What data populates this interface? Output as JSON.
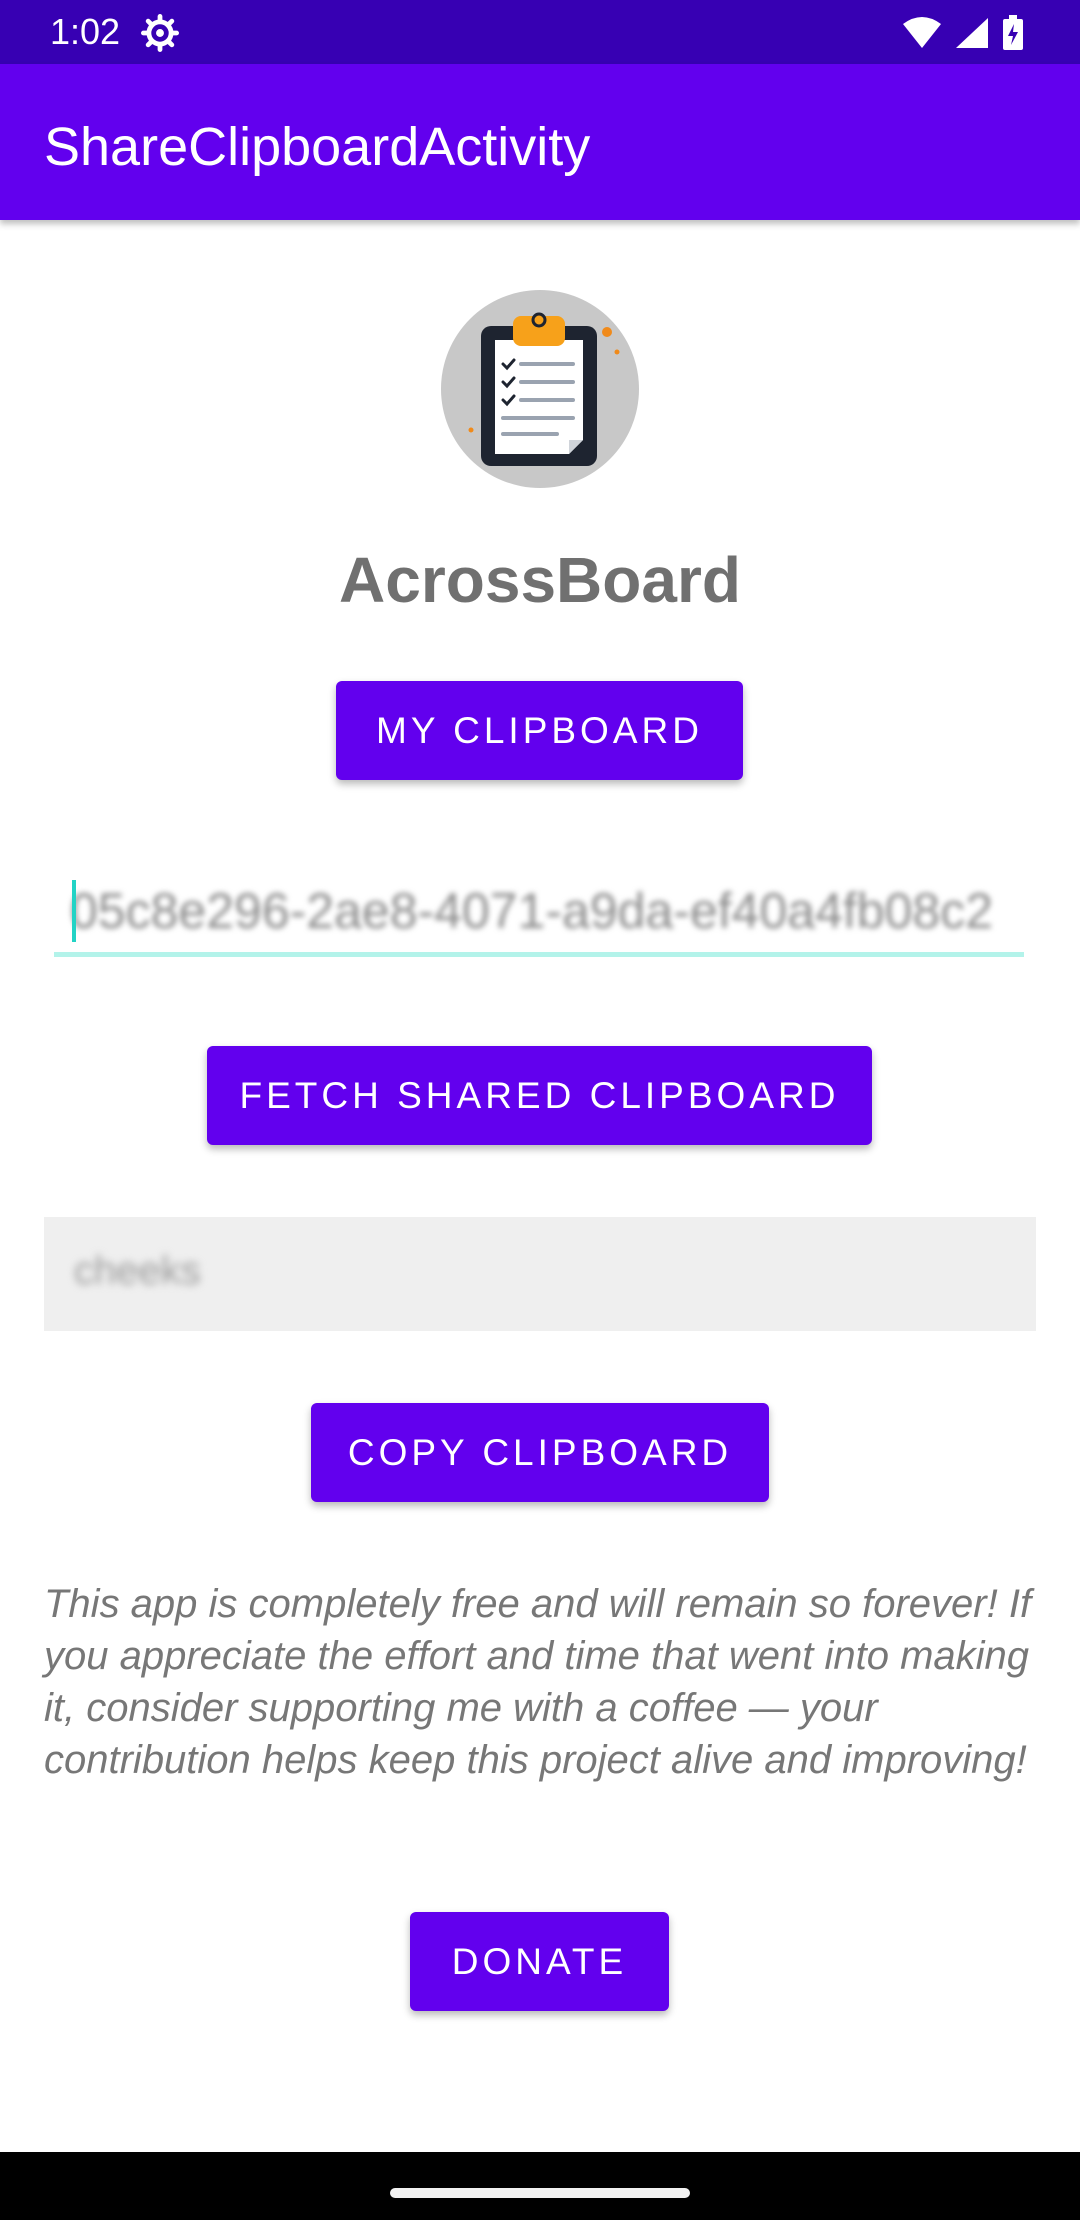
{
  "status_bar": {
    "time": "1:02",
    "icons": [
      "settings-gear-icon",
      "wifi-icon",
      "signal-icon",
      "battery-icon"
    ]
  },
  "app_bar": {
    "title": "ShareClipboardActivity"
  },
  "main": {
    "app_name": "AcrossBoard",
    "my_clipboard_label": "MY CLIPBOARD",
    "clipboard_id_value": "05c8e296-2ae8-4071-a9da-ef40a4fb08c2",
    "fetch_label": "FETCH SHARED CLIPBOARD",
    "clipboard_content": "cheeks",
    "copy_label": "COPY CLIPBOARD",
    "note": "This app is completely free and will remain so forever! If you appreciate the effort and time that went into making it, consider supporting me with a coffee — your contribution helps keep this project alive and improving!",
    "donate_label": "DONATE"
  },
  "colors": {
    "primary": "#6200EE",
    "primary_dark": "#3700B3",
    "accent": "#03DAC5"
  }
}
